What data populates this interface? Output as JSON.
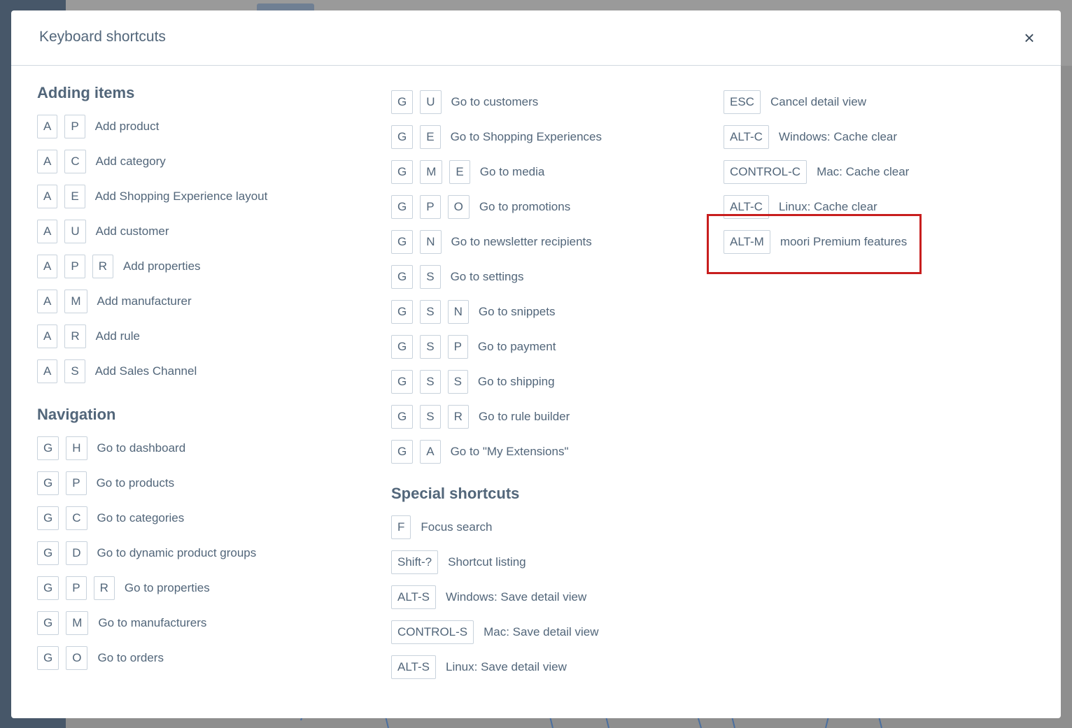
{
  "modal": {
    "title": "Keyboard shortcuts",
    "close_icon": "close-icon",
    "close_glyph": "×"
  },
  "adding_items": {
    "title": "Adding items",
    "rows": [
      {
        "keys": [
          "A",
          "P"
        ],
        "label": "Add product"
      },
      {
        "keys": [
          "A",
          "C"
        ],
        "label": "Add category"
      },
      {
        "keys": [
          "A",
          "E"
        ],
        "label": "Add Shopping Experience layout"
      },
      {
        "keys": [
          "A",
          "U"
        ],
        "label": "Add customer"
      },
      {
        "keys": [
          "A",
          "P",
          "R"
        ],
        "label": "Add properties"
      },
      {
        "keys": [
          "A",
          "M"
        ],
        "label": "Add manufacturer"
      },
      {
        "keys": [
          "A",
          "R"
        ],
        "label": "Add rule"
      },
      {
        "keys": [
          "A",
          "S"
        ],
        "label": "Add Sales Channel"
      }
    ]
  },
  "navigation": {
    "title": "Navigation",
    "rows": [
      {
        "keys": [
          "G",
          "H"
        ],
        "label": "Go to dashboard"
      },
      {
        "keys": [
          "G",
          "P"
        ],
        "label": "Go to products"
      },
      {
        "keys": [
          "G",
          "C"
        ],
        "label": "Go to categories"
      },
      {
        "keys": [
          "G",
          "D"
        ],
        "label": "Go to dynamic product groups"
      },
      {
        "keys": [
          "G",
          "P",
          "R"
        ],
        "label": "Go to properties"
      },
      {
        "keys": [
          "G",
          "M"
        ],
        "label": "Go to manufacturers"
      },
      {
        "keys": [
          "G",
          "O"
        ],
        "label": "Go to orders"
      }
    ]
  },
  "navigation_cont": {
    "rows": [
      {
        "keys": [
          "G",
          "U"
        ],
        "label": "Go to customers"
      },
      {
        "keys": [
          "G",
          "E"
        ],
        "label": "Go to Shopping Experiences"
      },
      {
        "keys": [
          "G",
          "M",
          "E"
        ],
        "label": "Go to media"
      },
      {
        "keys": [
          "G",
          "P",
          "O"
        ],
        "label": "Go to promotions"
      },
      {
        "keys": [
          "G",
          "N"
        ],
        "label": "Go to newsletter recipients"
      },
      {
        "keys": [
          "G",
          "S"
        ],
        "label": "Go to settings"
      },
      {
        "keys": [
          "G",
          "S",
          "N"
        ],
        "label": "Go to snippets"
      },
      {
        "keys": [
          "G",
          "S",
          "P"
        ],
        "label": "Go to payment"
      },
      {
        "keys": [
          "G",
          "S",
          "S"
        ],
        "label": "Go to shipping"
      },
      {
        "keys": [
          "G",
          "S",
          "R"
        ],
        "label": "Go to rule builder"
      },
      {
        "keys": [
          "G",
          "A"
        ],
        "label": "Go to \"My Extensions\""
      }
    ]
  },
  "special": {
    "title": "Special shortcuts",
    "rows": [
      {
        "keys": [
          "F"
        ],
        "label": "Focus search"
      },
      {
        "keys": [
          "Shift-?"
        ],
        "label": "Shortcut listing"
      },
      {
        "keys": [
          "ALT-S"
        ],
        "label": "Windows: Save detail view"
      },
      {
        "keys": [
          "CONTROL-S"
        ],
        "label": "Mac: Save detail view"
      },
      {
        "keys": [
          "ALT-S"
        ],
        "label": "Linux: Save detail view"
      }
    ]
  },
  "special_cont": {
    "rows": [
      {
        "keys": [
          "ESC"
        ],
        "label": "Cancel detail view"
      },
      {
        "keys": [
          "ALT-C"
        ],
        "label": "Windows: Cache clear"
      },
      {
        "keys": [
          "CONTROL-C"
        ],
        "label": "Mac: Cache clear"
      },
      {
        "keys": [
          "ALT-C"
        ],
        "label": "Linux: Cache clear"
      },
      {
        "keys": [
          "ALT-M"
        ],
        "label": "moori Premium features"
      }
    ]
  },
  "colors": {
    "text": "#52667a",
    "key_border": "#c8d2dc",
    "highlight": "#c81e1e"
  }
}
